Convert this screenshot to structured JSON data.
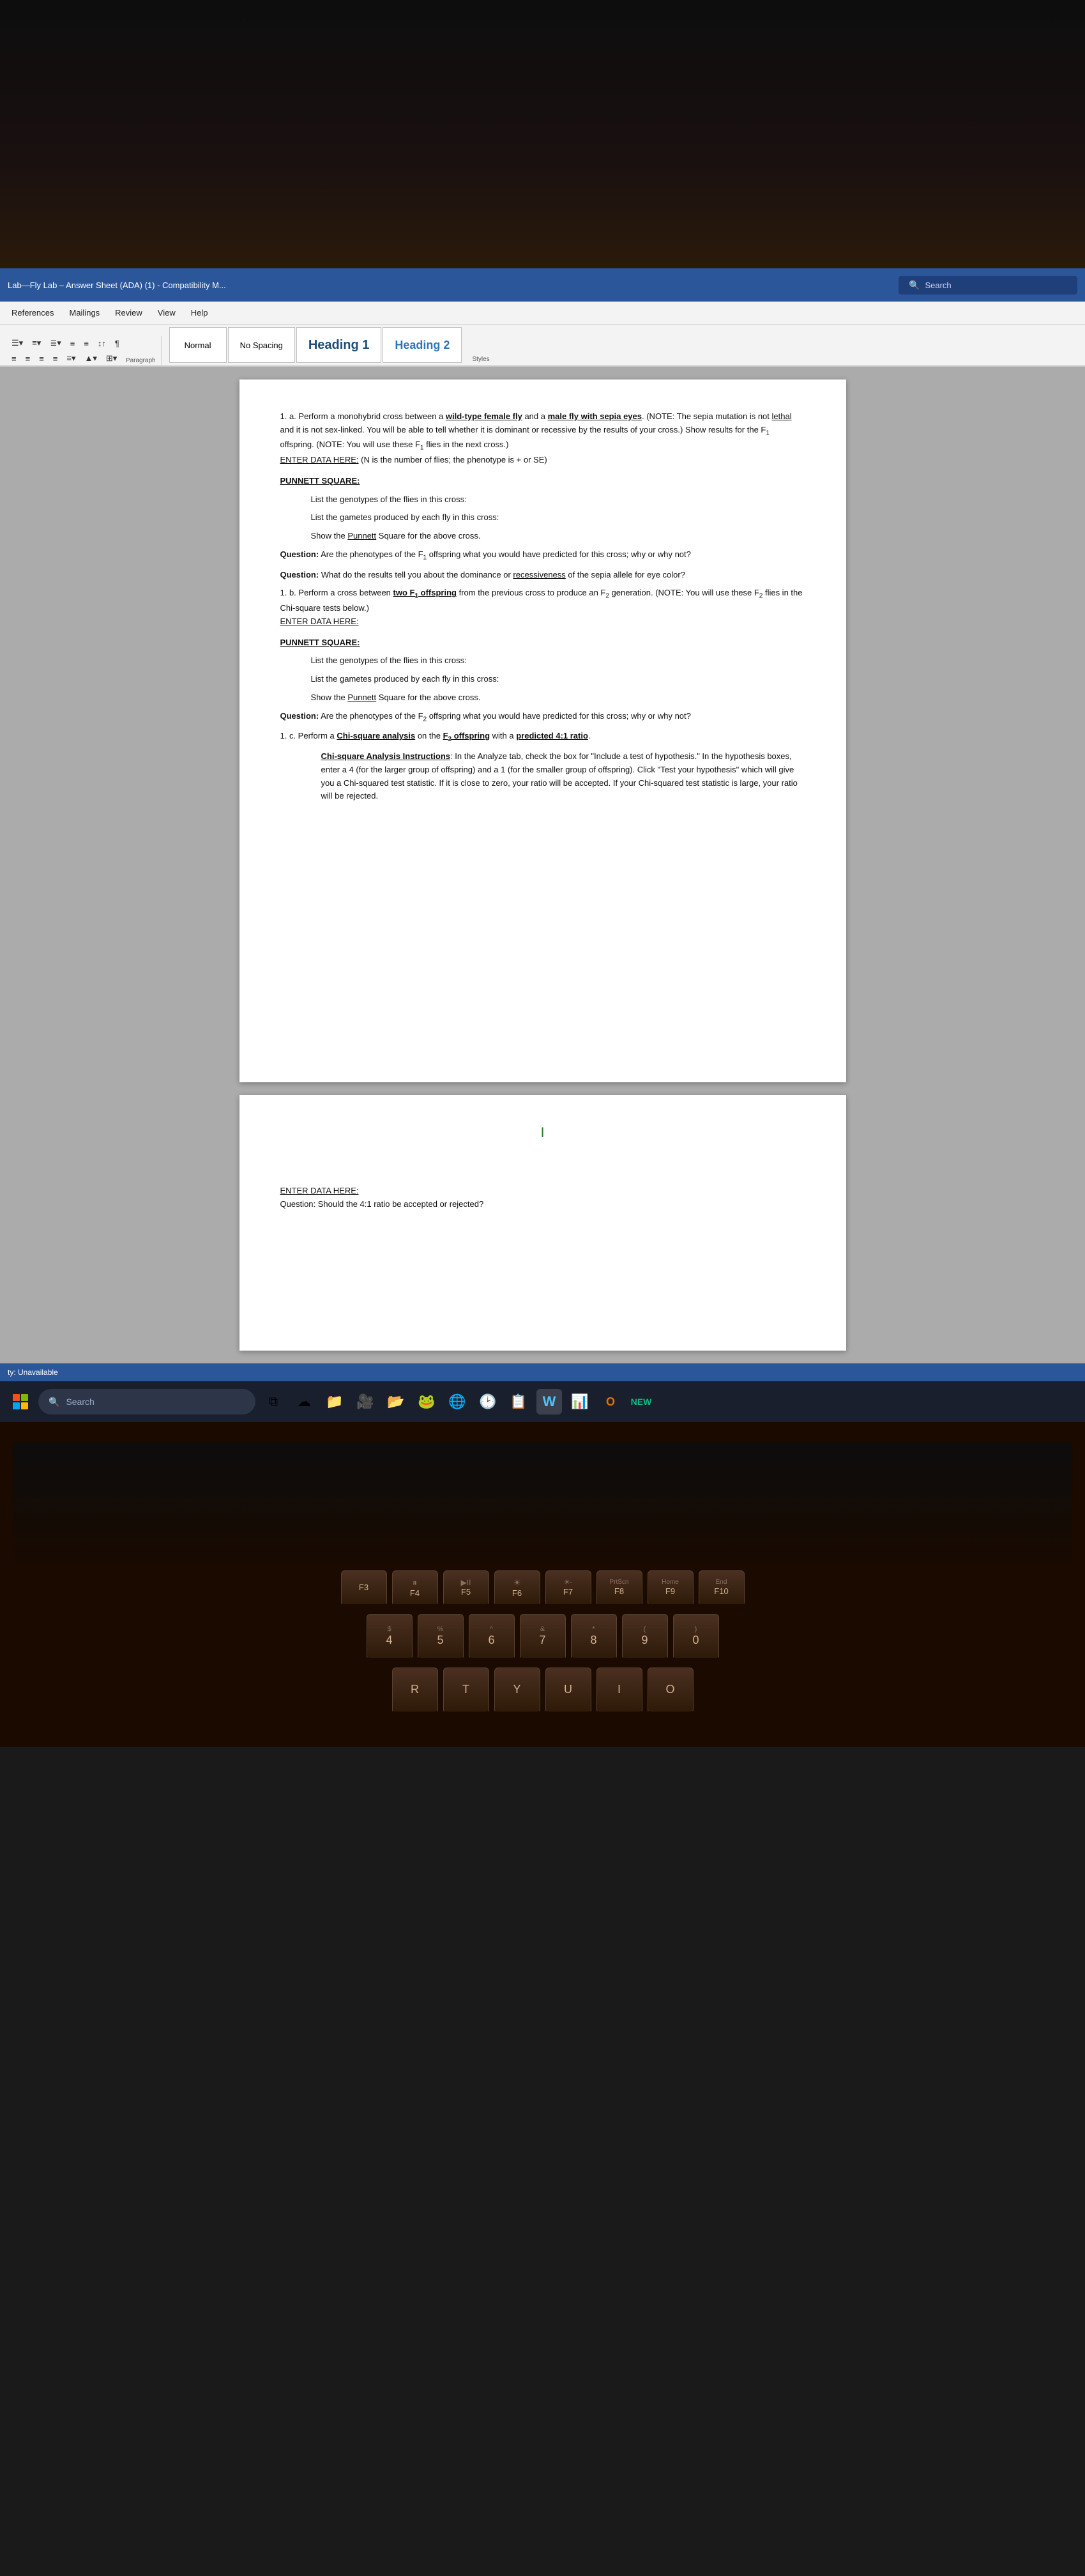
{
  "titleBar": {
    "title": "Lab—Fly Lab – Answer Sheet (ADA) (1)  -  Compatibility M...",
    "searchPlaceholder": "Search",
    "searchLabel": "Search"
  },
  "menuBar": {
    "items": [
      "References",
      "Mailings",
      "Review",
      "View",
      "Help"
    ]
  },
  "ribbon": {
    "paragraphLabel": "Paragraph",
    "stylesLabel": "Styles",
    "styles": [
      {
        "id": "normal",
        "label": "Normal"
      },
      {
        "id": "no-spacing",
        "label": "No Spacing"
      },
      {
        "id": "heading1",
        "label": "Heading 1"
      },
      {
        "id": "heading2",
        "label": "Heading 2"
      }
    ]
  },
  "document": {
    "section1": {
      "intro": "1. a. Perform a monohybrid cross between a wild-type female fly and a male fly with sepia eyes. (NOTE: The sepia mutation is not lethal and it is not sex-linked. You will be able to tell whether it is dominant or recessive by the results of your cross.) Show results for the F₁ offspring. (NOTE: You will use these F₁ flies in the next cross.)",
      "enterDataHere": "ENTER DATA HERE:",
      "enterDataNote": "(N is the number of flies; the phenotype is + or SE)",
      "punnettLabel": "PUNNETT SQUARE:",
      "indent1a": "List the genotypes of the flies in this cross:",
      "indent1b": "List the gametes produced by each fly in this cross:",
      "indent1c": "Show the Punnett Square for the above cross.",
      "q1": "Question: Are the phenotypes of the F₁ offspring what you would have predicted for this cross; why or why not?",
      "q2": "Question: What do the results tell you about the dominance or recessiveness of the sepia allele for eye color?"
    },
    "section1b": {
      "intro": "1. b. Perform a cross between two F₁ offspring from the previous cross to produce an F₂ generation. (NOTE: You will use these F₂ flies in the Chi-square tests below.)",
      "enterDataHere": "ENTER DATA HERE:",
      "punnettLabel": "PUNNETT SQUARE:",
      "indent1": "List the genotypes of the flies in this cross:",
      "indent2": "List the gametes produced by each fly in this cross:",
      "indent3": "Show the Punnett Square for the above cross.",
      "q3": "Question: Are the phenotypes of the F₂ offspring what you would have predicted for this cross; why or why not?"
    },
    "section1c": {
      "intro": "1. c. Perform a Chi-square analysis on the F₂ offspring with a predicted 4:1 ratio.",
      "chiInstructions": "Chi-square Analysis Instructions: In the Analyze tab, check the box for \"Include a test of hypothesis.\" In the hypothesis boxes, enter a 4 (for the larger group of offspring) and a 1 (for the smaller group of offspring). Click \"Test your hypothesis\" which will give you a Chi-squared test statistic. If it is close to zero, your ratio will be accepted. If your Chi-squared test statistic is large, your ratio will be rejected."
    },
    "page2": {
      "cursorSymbol": "I",
      "enterDataHere": "ENTER DATA HERE:",
      "q4": "Question: Should the 4:1 ratio be accepted or rejected?"
    }
  },
  "statusBar": {
    "text": "ty: Unavailable"
  },
  "taskbar": {
    "searchLabel": "Search",
    "icons": [
      {
        "name": "task-view",
        "symbol": "⧉"
      },
      {
        "name": "zoom-widget",
        "symbol": "☁"
      },
      {
        "name": "file-explorer",
        "symbol": "📁"
      },
      {
        "name": "zoom-app",
        "symbol": "🎥"
      },
      {
        "name": "folder",
        "symbol": "📂"
      },
      {
        "name": "app5",
        "symbol": "🐸"
      },
      {
        "name": "chrome",
        "symbol": "🌐"
      },
      {
        "name": "app7",
        "symbol": "🕑"
      },
      {
        "name": "app8",
        "symbol": "📋"
      },
      {
        "name": "word",
        "symbol": "W"
      },
      {
        "name": "app10",
        "symbol": "📊"
      },
      {
        "name": "office",
        "symbol": "O"
      },
      {
        "name": "new-app",
        "symbol": "N"
      }
    ]
  },
  "keyboard": {
    "rows": [
      {
        "id": "fn-row",
        "keys": [
          {
            "top": "",
            "main": "F3",
            "sub": ""
          },
          {
            "top": "⏸",
            "main": "F4",
            "sub": ""
          },
          {
            "top": "▶II",
            "main": "F5",
            "sub": ""
          },
          {
            "top": "☀",
            "main": "F6",
            "sub": ""
          },
          {
            "top": "☀-",
            "main": "F7",
            "sub": ""
          },
          {
            "top": "PrtScn",
            "main": "F8",
            "sub": ""
          },
          {
            "top": "Home",
            "main": "F9",
            "sub": ""
          },
          {
            "top": "End",
            "main": "F10",
            "sub": ""
          }
        ]
      },
      {
        "id": "num-row",
        "keys": [
          {
            "top": "$",
            "main": "4",
            "sub": ""
          },
          {
            "top": "%",
            "main": "5",
            "sub": ""
          },
          {
            "top": "^",
            "main": "6",
            "sub": ""
          },
          {
            "top": "&",
            "main": "7",
            "sub": ""
          },
          {
            "top": "*",
            "main": "8",
            "sub": ""
          },
          {
            "top": "(",
            "main": "9",
            "sub": ""
          },
          {
            "top": ")",
            "main": "0",
            "sub": ""
          }
        ]
      },
      {
        "id": "letter-row",
        "keys": [
          {
            "top": "",
            "main": "R",
            "sub": ""
          },
          {
            "top": "",
            "main": "T",
            "sub": ""
          },
          {
            "top": "",
            "main": "Y",
            "sub": ""
          },
          {
            "top": "",
            "main": "U",
            "sub": ""
          },
          {
            "top": "",
            "main": "I",
            "sub": ""
          },
          {
            "top": "",
            "main": "O",
            "sub": ""
          }
        ]
      }
    ]
  }
}
